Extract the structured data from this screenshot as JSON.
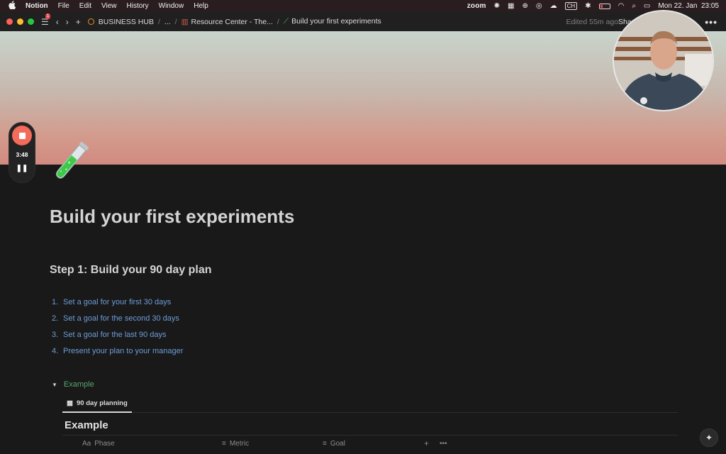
{
  "menubar": {
    "apple_icon": "apple-icon",
    "app_name": "Notion",
    "items": [
      "File",
      "Edit",
      "View",
      "History",
      "Window",
      "Help"
    ],
    "zoom_label": "zoom",
    "keyboard_label": "CH",
    "datetime": "Mon 22. Jan  23:05"
  },
  "titlebar": {
    "notification_count": "1",
    "breadcrumbs": {
      "workspace": "BUSINESS HUB",
      "ellipsis": "...",
      "parent": "Resource Center - The...",
      "current": "Build your first experiments"
    },
    "edited": "Edited 55m ago",
    "share": "Share",
    "more": "•••"
  },
  "recorder": {
    "time": "3:48"
  },
  "page": {
    "title": "Build your first experiments",
    "heading": "Step 1: Build your 90 day plan",
    "steps": [
      {
        "num": "1.",
        "text": "Set a goal for your first 30 days"
      },
      {
        "num": "2.",
        "text": "Set a goal for the second 30 days"
      },
      {
        "num": "3.",
        "text": "Set a goal for the last 90 days"
      },
      {
        "num": "4.",
        "text": "Present your plan to your manager"
      }
    ],
    "toggle_label": "Example",
    "database": {
      "tab": "90 day planning",
      "title": "Example",
      "columns": [
        {
          "prefix": "Aa",
          "label": "Phase"
        },
        {
          "prefix": "≡",
          "label": "Metric"
        },
        {
          "prefix": "≡",
          "label": "Goal"
        }
      ],
      "add": "+",
      "more": "•••"
    }
  },
  "colors": {
    "link_blue": "#6e9dd8",
    "toggle_green": "#57a66b",
    "record_red": "#f26b5b"
  }
}
